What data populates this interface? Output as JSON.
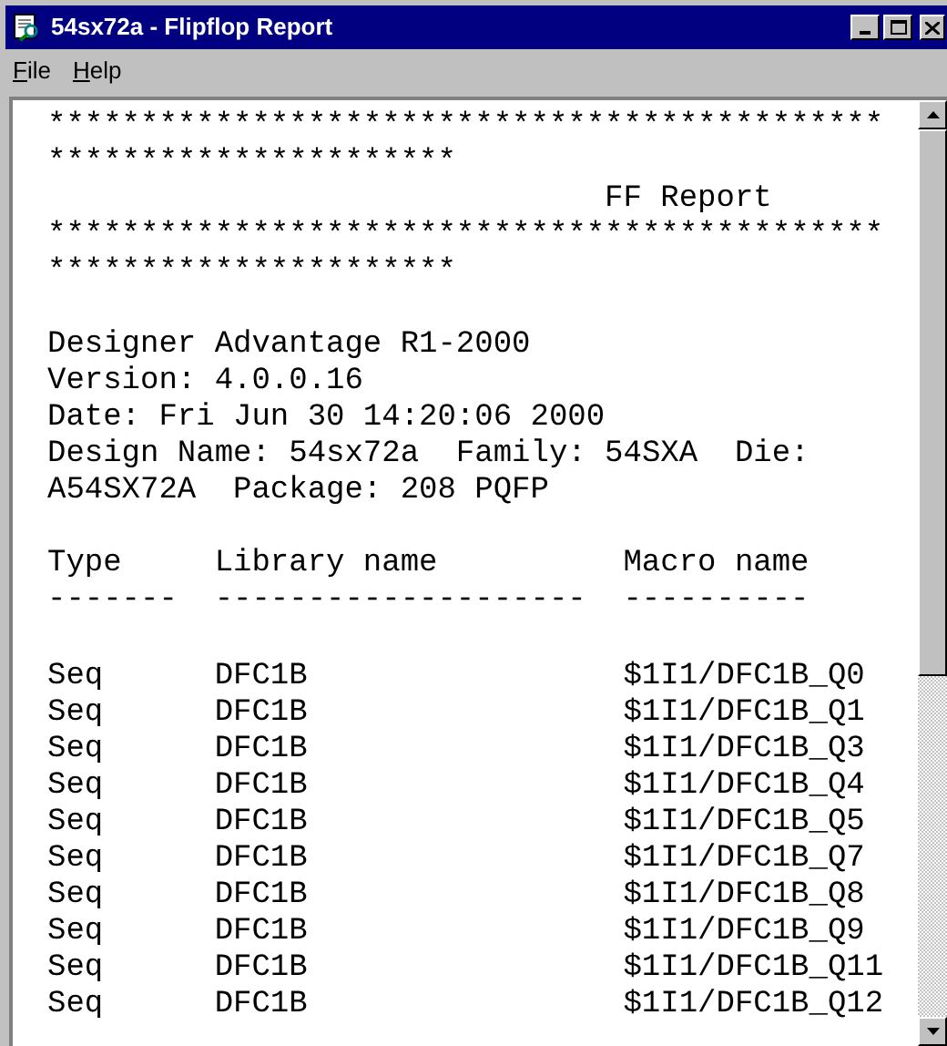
{
  "window": {
    "title": "54sx72a - Flipflop Report"
  },
  "menu": [
    {
      "label": "File"
    },
    {
      "label": "Help"
    }
  ],
  "report": {
    "banner": [
      {
        "kind": "text",
        "text": "*********************************************"
      },
      {
        "kind": "text",
        "text": "**********************"
      },
      {
        "kind": "title",
        "text": "FF Report"
      },
      {
        "kind": "text",
        "text": "*********************************************"
      },
      {
        "kind": "text",
        "text": "**********************"
      }
    ],
    "info": [
      "Designer Advantage R1-2000",
      "Version: 4.0.0.16",
      "Date: Fri Jun 30 14:20:06 2000",
      "Design Name: 54sx72a  Family: 54SXA  Die:",
      "A54SX72A  Package: 208 PQFP"
    ],
    "table": {
      "columns": [
        {
          "label": "Type",
          "rule": "-------"
        },
        {
          "label": "Library name",
          "rule": "--------------------"
        },
        {
          "label": "Macro name",
          "rule": "----------"
        }
      ],
      "rows": [
        [
          "Seq",
          "DFC1B",
          "$1I1/DFC1B_Q0"
        ],
        [
          "Seq",
          "DFC1B",
          "$1I1/DFC1B_Q1"
        ],
        [
          "Seq",
          "DFC1B",
          "$1I1/DFC1B_Q3"
        ],
        [
          "Seq",
          "DFC1B",
          "$1I1/DFC1B_Q4"
        ],
        [
          "Seq",
          "DFC1B",
          "$1I1/DFC1B_Q5"
        ],
        [
          "Seq",
          "DFC1B",
          "$1I1/DFC1B_Q7"
        ],
        [
          "Seq",
          "DFC1B",
          "$1I1/DFC1B_Q8"
        ],
        [
          "Seq",
          "DFC1B",
          "$1I1/DFC1B_Q9"
        ],
        [
          "Seq",
          "DFC1B",
          "$1I1/DFC1B_Q11"
        ],
        [
          "Seq",
          "DFC1B",
          "$1I1/DFC1B_Q12"
        ]
      ]
    }
  }
}
